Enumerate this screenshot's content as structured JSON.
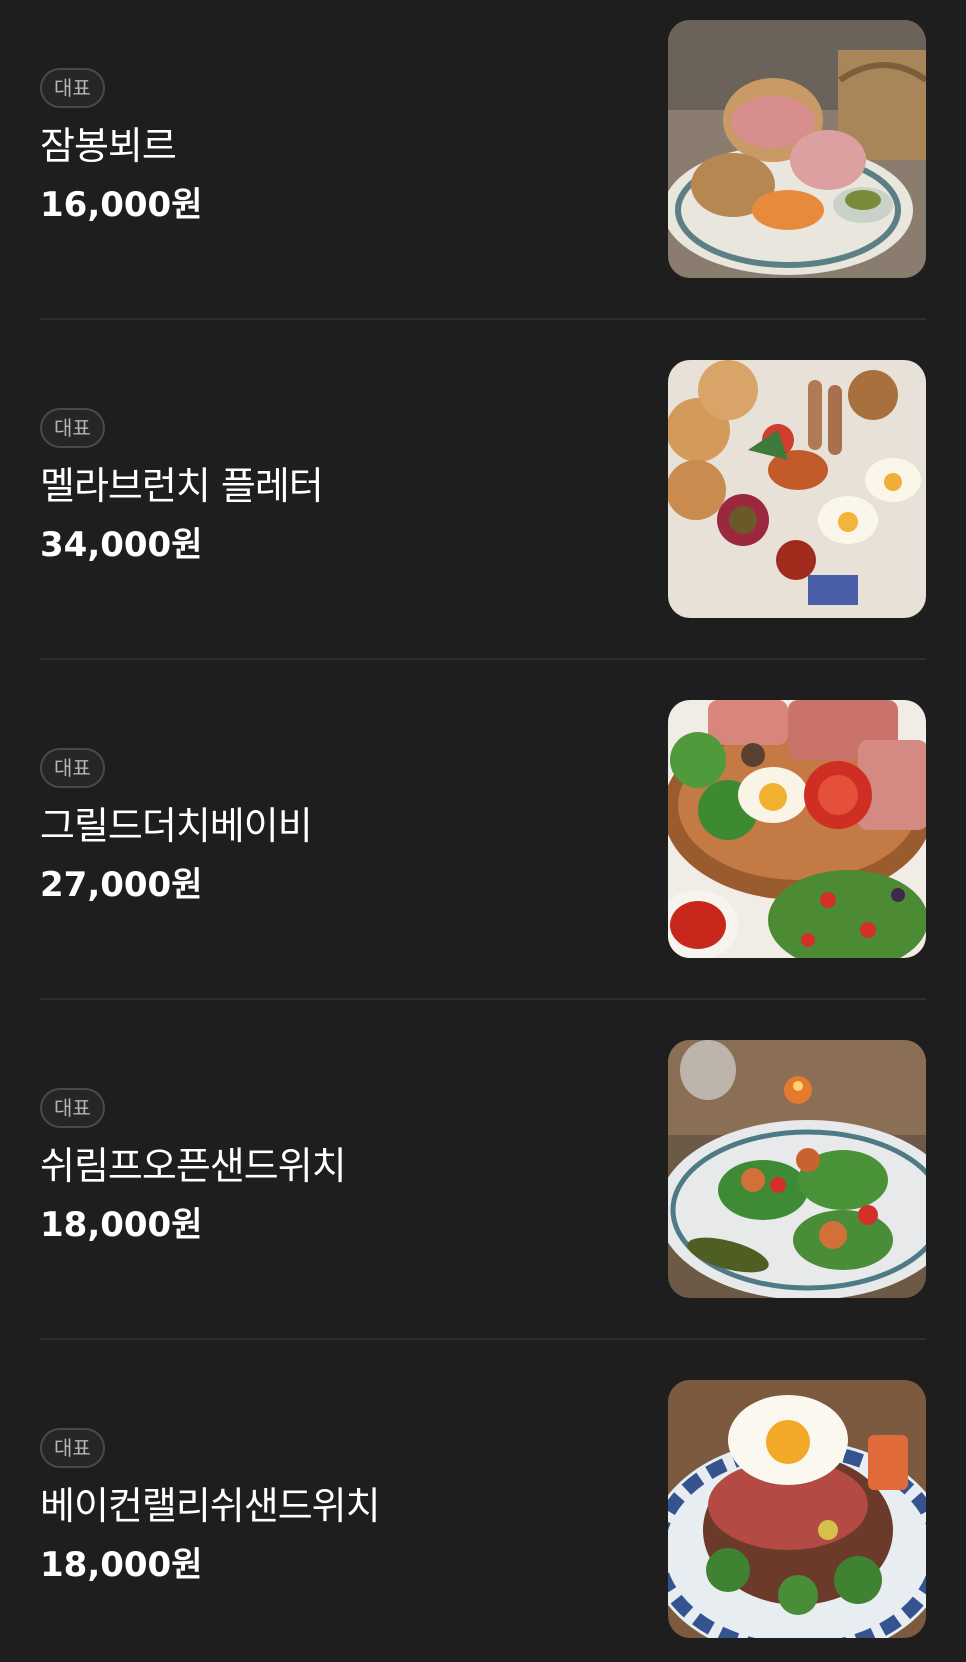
{
  "menu": {
    "items": [
      {
        "badge": "대표",
        "name": "잠봉뵈르",
        "price": "16,000원",
        "photo": "jambon-beurre-plate"
      },
      {
        "badge": "대표",
        "name": "멜라브런치 플레터",
        "price": "34,000원",
        "photo": "brunch-platter"
      },
      {
        "badge": "대표",
        "name": "그릴드더치베이비",
        "price": "27,000원",
        "photo": "dutch-baby-plate"
      },
      {
        "badge": "대표",
        "name": "쉬림프오픈샌드위치",
        "price": "18,000원",
        "photo": "shrimp-open-sandwich"
      },
      {
        "badge": "대표",
        "name": "베이컨랠리쉬샌드위치",
        "price": "18,000원",
        "photo": "bacon-relish-sandwich"
      }
    ]
  }
}
